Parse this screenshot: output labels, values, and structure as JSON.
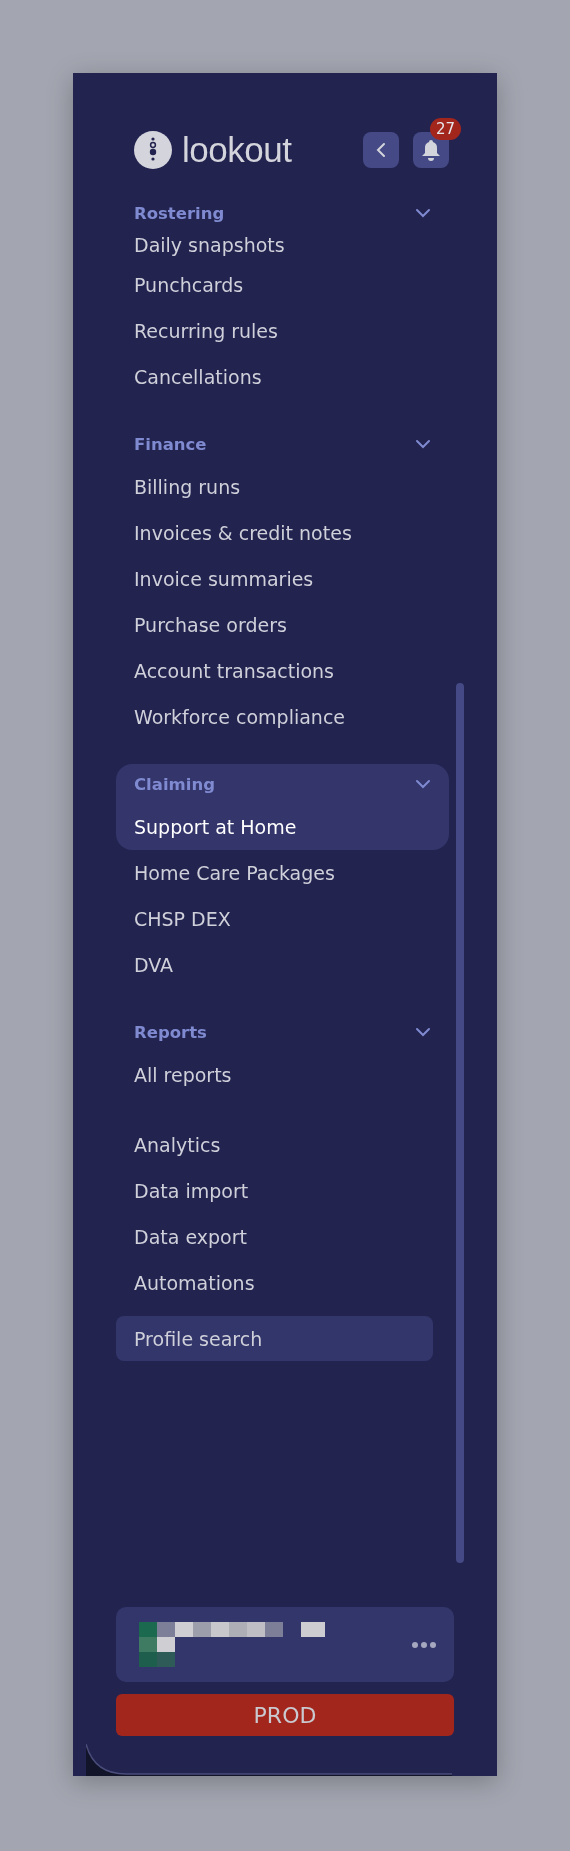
{
  "brand": {
    "name": "lookout"
  },
  "notifications": {
    "count": "27"
  },
  "sections": [
    {
      "title": "Rostering",
      "expanded": true,
      "items": [
        {
          "label": "Daily snapshots",
          "selected": false
        },
        {
          "label": "Punchcards",
          "selected": false
        },
        {
          "label": "Recurring rules",
          "selected": false
        },
        {
          "label": "Cancellations",
          "selected": false
        }
      ]
    },
    {
      "title": "Finance",
      "expanded": true,
      "items": [
        {
          "label": "Billing runs",
          "selected": false
        },
        {
          "label": "Invoices & credit notes",
          "selected": false
        },
        {
          "label": "Invoice summaries",
          "selected": false
        },
        {
          "label": "Purchase orders",
          "selected": false
        },
        {
          "label": "Account transactions",
          "selected": false
        },
        {
          "label": "Workforce compliance",
          "selected": false
        }
      ]
    },
    {
      "title": "Claiming",
      "expanded": true,
      "items": [
        {
          "label": "Support at Home",
          "selected": true
        },
        {
          "label": "Home Care Packages",
          "selected": false
        },
        {
          "label": "CHSP DEX",
          "selected": false
        },
        {
          "label": "DVA",
          "selected": false
        }
      ]
    },
    {
      "title": "Reports",
      "expanded": true,
      "items": [
        {
          "label": "All reports",
          "selected": false
        }
      ]
    },
    {
      "items": [
        {
          "label": "Analytics",
          "selected": false
        },
        {
          "label": "Data import",
          "selected": false
        },
        {
          "label": "Data export",
          "selected": false
        },
        {
          "label": "Automations",
          "selected": false
        }
      ]
    }
  ],
  "profile_search": {
    "label": "Profile search"
  },
  "environment": {
    "label": "PROD"
  }
}
